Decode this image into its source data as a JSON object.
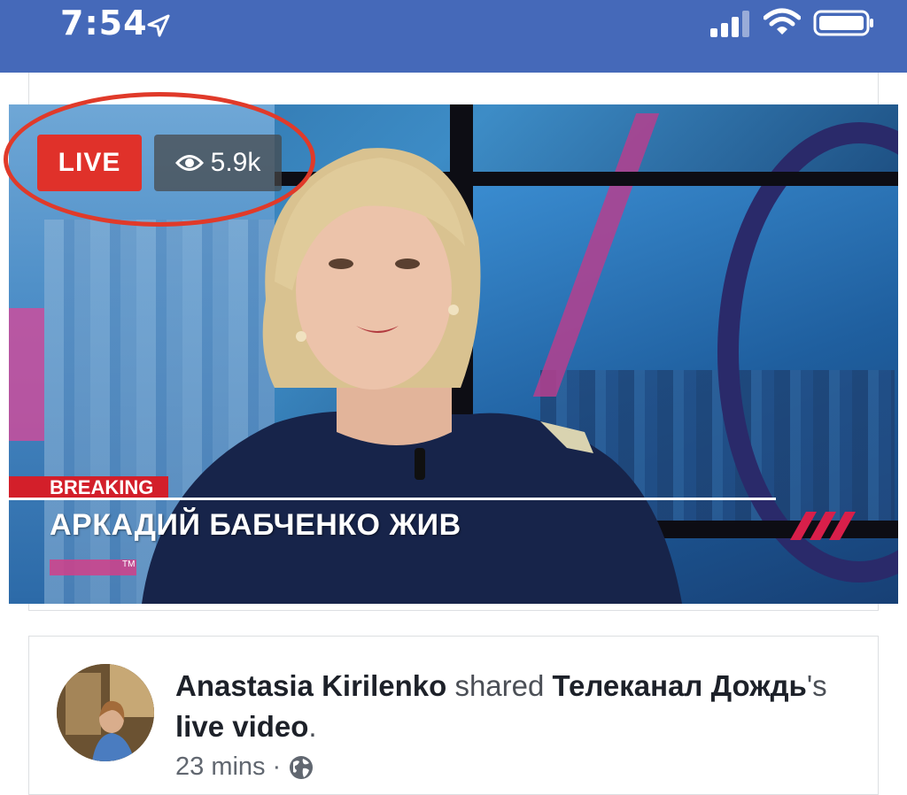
{
  "status_bar": {
    "time": "7:54",
    "icons": [
      "location-arrow-icon",
      "signal-icon",
      "wifi-icon",
      "battery-icon"
    ]
  },
  "video": {
    "live_label": "LIVE",
    "viewers": "5.9k",
    "breaking_label": "BREAKING",
    "headline": "АРКАДИЙ БАБЧЕНКО ЖИВ",
    "ticker_mark": "TM"
  },
  "post": {
    "author": "Anastasia Kirilenko",
    "action": "shared",
    "page": "Телеканал Дождь",
    "possessive": "'s",
    "object": "live video",
    "period": ".",
    "time": "23 mins",
    "separator": "·",
    "privacy_icon": "globe-icon"
  },
  "colors": {
    "status_bar_bg": "#4569b9",
    "live_badge": "#e0312a",
    "highlight_circle": "#e03a2a",
    "breaking": "#d31f2a"
  }
}
